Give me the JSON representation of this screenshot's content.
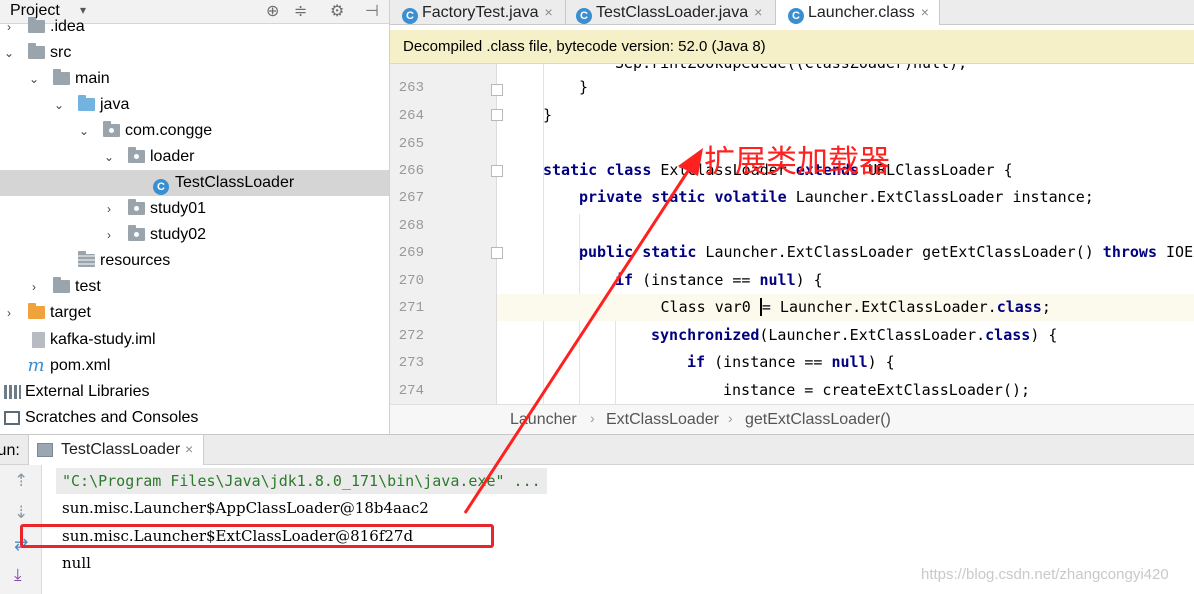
{
  "project": {
    "title": "Project",
    "tree": [
      {
        "label": ".idea",
        "icon": "folder-gray",
        "arrow": "›",
        "depth": 0
      },
      {
        "label": "src",
        "icon": "folder-gray",
        "arrow": "⌄",
        "depth": 0
      },
      {
        "label": "main",
        "icon": "folder-gray",
        "arrow": "⌄",
        "depth": 1
      },
      {
        "label": "java",
        "icon": "folder-blue",
        "arrow": "⌄",
        "depth": 2
      },
      {
        "label": "com.congge",
        "icon": "package",
        "arrow": "⌄",
        "depth": 3
      },
      {
        "label": "loader",
        "icon": "package",
        "arrow": "⌄",
        "depth": 4
      },
      {
        "label": "TestClassLoader",
        "icon": "class",
        "arrow": "",
        "depth": 5,
        "selected": true
      },
      {
        "label": "study01",
        "icon": "package",
        "arrow": "›",
        "depth": 4
      },
      {
        "label": "study02",
        "icon": "package",
        "arrow": "›",
        "depth": 4
      },
      {
        "label": "resources",
        "icon": "resources",
        "arrow": "",
        "depth": 3
      },
      {
        "label": "test",
        "icon": "folder-gray",
        "arrow": "›",
        "depth": 1
      },
      {
        "label": "target",
        "icon": "folder-orange",
        "arrow": "›",
        "depth": 0
      },
      {
        "label": "kafka-study.iml",
        "icon": "file",
        "arrow": "",
        "depth": 1
      },
      {
        "label": "pom.xml",
        "icon": "maven",
        "arrow": "",
        "depth": 1
      },
      {
        "label": "External Libraries",
        "icon": "libs",
        "arrow": "",
        "depth": -1
      },
      {
        "label": "Scratches and Consoles",
        "icon": "scratch",
        "arrow": "",
        "depth": -1
      }
    ]
  },
  "editor": {
    "tabs": [
      {
        "label": "FactoryTest.java",
        "active": false
      },
      {
        "label": "TestClassLoader.java",
        "active": false
      },
      {
        "label": "Launcher.class",
        "active": true
      }
    ],
    "tab_close": "×",
    "banner": "Decompiled .class file, bytecode version: 52.0 (Java 8)",
    "line_numbers": [
      "263",
      "264",
      "265",
      "266",
      "267",
      "268",
      "269",
      "270",
      "271",
      "272",
      "273",
      "274"
    ],
    "breadcrumb": [
      "Launcher",
      "ExtClassLoader",
      "getExtClassLoader()"
    ],
    "breadcrumb_sep": "›"
  },
  "run": {
    "label": "Run:",
    "tab_label": "TestClassLoader",
    "tab_close": "×",
    "console": [
      "\"C:\\Program Files\\Java\\jdk1.8.0_171\\bin\\java.exe\" ...",
      "sun.misc.Launcher$AppClassLoader@18b4aac2",
      "sun.misc.Launcher$ExtClassLoader@816f27d",
      "null"
    ]
  },
  "annotation": {
    "label": "扩展类加载器",
    "color": "#ff2020"
  },
  "watermark": "https://blog.csdn.net/zhangcongyi420"
}
